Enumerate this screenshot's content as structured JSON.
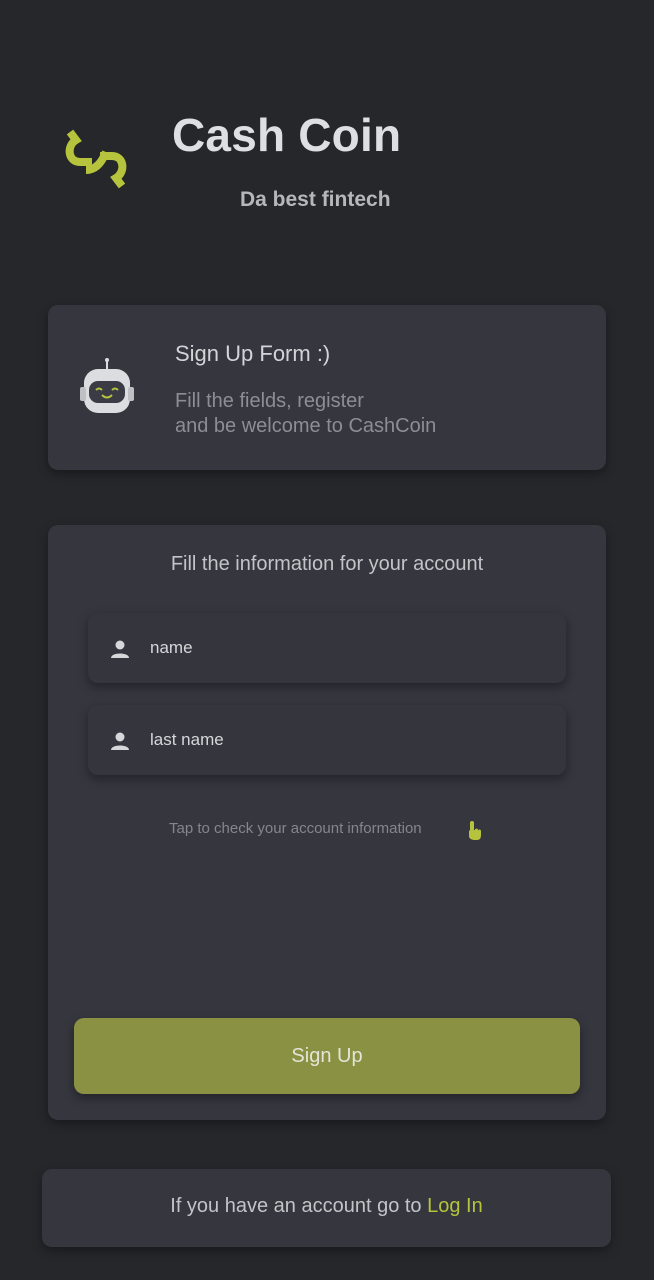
{
  "header": {
    "logo_icon": "cash-coin-logo-icon",
    "title": "Cash Coin",
    "subtitle": "Da best fintech"
  },
  "intro": {
    "icon": "robot-icon",
    "title": "Sign Up Form :)",
    "line1": "Fill the fields, register",
    "line2": "and be welcome to CashCoin"
  },
  "form": {
    "heading": "Fill the information for your account",
    "name_placeholder": "name",
    "lastname_placeholder": "last name",
    "field_icon": "person-icon",
    "tap_hint": "Tap to check your account information",
    "tap_icon": "tap-hand-icon",
    "submit_label": "Sign Up"
  },
  "footer": {
    "text": "If you have an account go to ",
    "link": "Log In"
  },
  "colors": {
    "background": "#26272b",
    "card": "#35363e",
    "accent": "#b5c43c",
    "button": "#8a9142"
  }
}
